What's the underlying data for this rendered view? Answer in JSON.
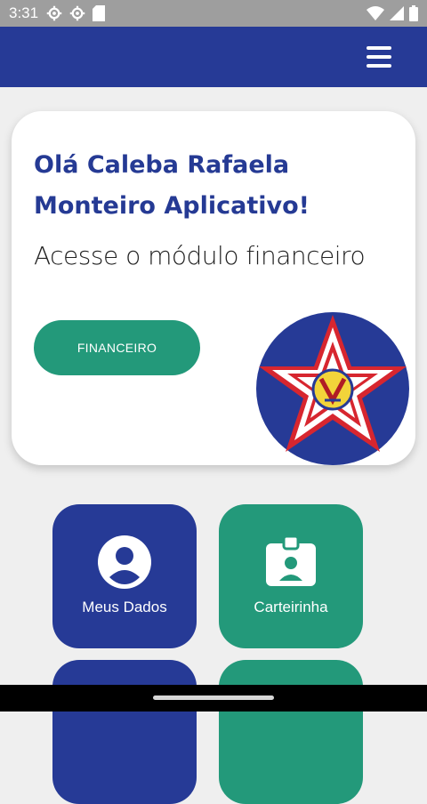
{
  "status_bar": {
    "time": "3:31"
  },
  "card": {
    "greeting": "Olá Caleba Rafaela Monteiro Aplicativo!",
    "subtitle": "Acesse o módulo financeiro",
    "button_label": "FINANCEIRO"
  },
  "tiles": [
    {
      "label": "Meus Dados",
      "icon": "account-circle-icon",
      "color": "#263a96"
    },
    {
      "label": "Carteirinha",
      "icon": "badge-icon",
      "color": "#23997a"
    }
  ],
  "colors": {
    "primary": "#263a96",
    "accent": "#23997a",
    "background": "#efefef"
  }
}
